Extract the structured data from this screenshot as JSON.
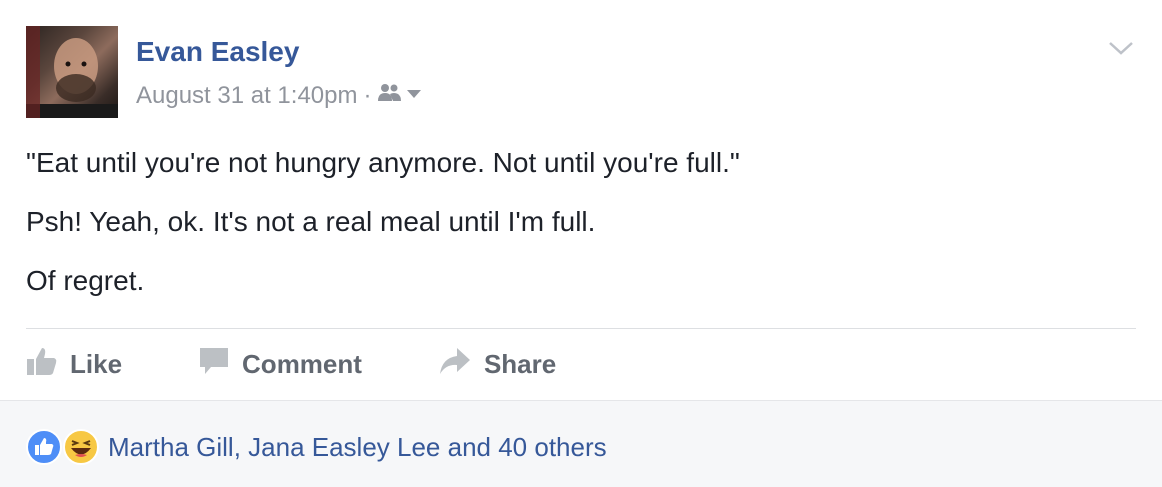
{
  "post": {
    "author": "Evan Easley",
    "timestamp": "August 31 at 1:40pm",
    "separator": "·",
    "audience_icon": "friends-icon",
    "options_icon": "chevron-down-icon",
    "paragraphs": [
      "\"Eat until you're not hungry anymore. Not until you're full.\"",
      "Psh! Yeah, ok. It's not a real meal until I'm full.",
      "Of regret."
    ]
  },
  "actions": {
    "like_label": "Like",
    "comment_label": "Comment",
    "share_label": "Share"
  },
  "reactions": {
    "icons": [
      "like-reaction-icon",
      "haha-reaction-icon"
    ],
    "summary": "Martha Gill, Jana Easley Lee and 40 others"
  },
  "colors": {
    "link_blue": "#365899",
    "meta_gray": "#90949c",
    "action_gray": "#616770",
    "like_blue": "#4267b2",
    "haha_yellow": "#f7c844",
    "footer_bg": "#f6f7f9"
  }
}
